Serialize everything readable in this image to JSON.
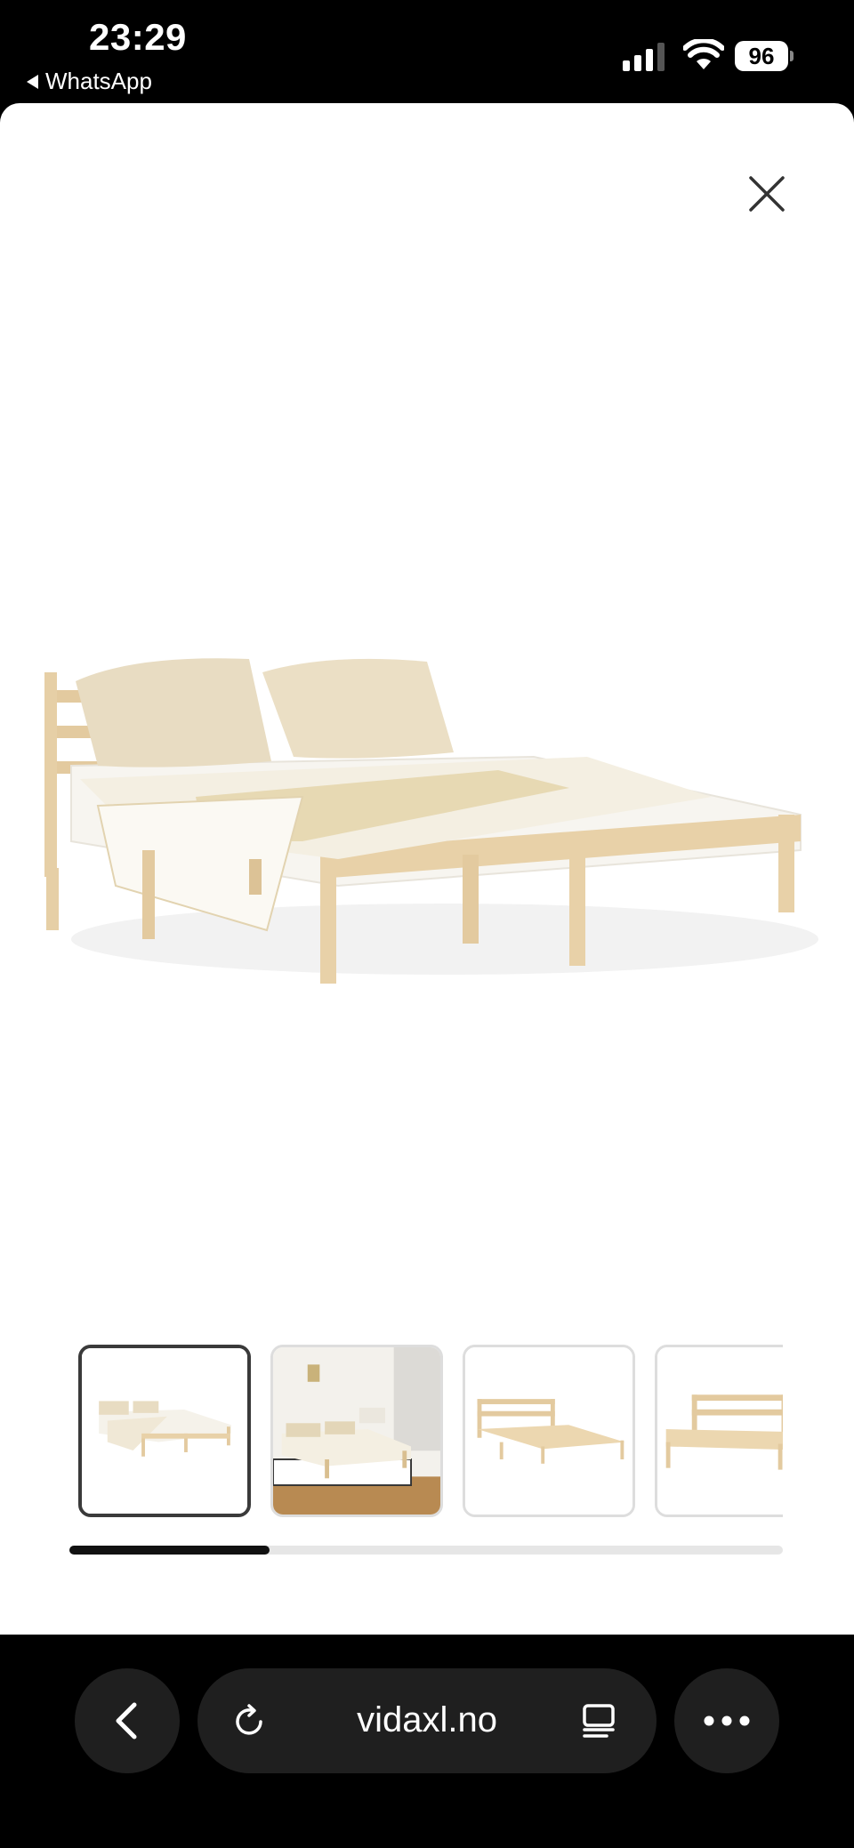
{
  "status_bar": {
    "time": "23:29",
    "back_app": "WhatsApp",
    "battery": "96"
  },
  "viewer": {
    "close_icon": "close-icon",
    "main_image": "bed-frame-product-image",
    "thumbnails": [
      {
        "name": "bed-front-angle",
        "selected": true
      },
      {
        "name": "bed-room-scene",
        "selected": false
      },
      {
        "name": "bed-frame-empty-side",
        "selected": false
      },
      {
        "name": "bed-frame-empty-headboard",
        "selected": false
      }
    ],
    "scroll_progress": 0.28
  },
  "browser": {
    "url": "vidaxl.no",
    "icons": [
      "chevron-left-icon",
      "reload-icon",
      "reader-icon",
      "more-icon"
    ]
  }
}
